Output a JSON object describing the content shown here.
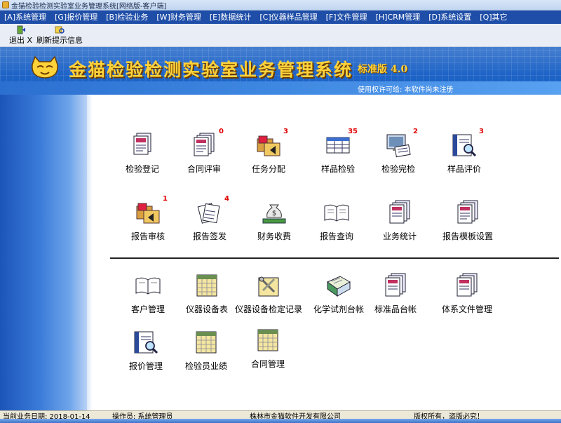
{
  "window": {
    "title": "金猫检验检测实验室业务管理系统[网络版-客户端]"
  },
  "menu": [
    {
      "label": "[A]系统管理"
    },
    {
      "label": "[G]报价管理"
    },
    {
      "label": "[B]检验业务"
    },
    {
      "label": "[W]财务管理"
    },
    {
      "label": "[E]数据统计"
    },
    {
      "label": "[C]仪器样品管理"
    },
    {
      "label": "[F]文件管理"
    },
    {
      "label": "[H]CRM管理"
    },
    {
      "label": "[D]系统设置"
    },
    {
      "label": "[Q]其它"
    }
  ],
  "toolbar": {
    "exit_label": "退出 X",
    "refresh_label": "刷新提示信息"
  },
  "banner": {
    "title": "金猫检验检测实验室业务管理系统",
    "edition": "标准版 4.0",
    "license": "使用权许可给:    本软件尚未注册"
  },
  "modules_row1": [
    {
      "label": "检验登记",
      "badge": "",
      "icon": "register-icon"
    },
    {
      "label": "合同评审",
      "badge": "0",
      "icon": "contract-review-icon"
    },
    {
      "label": "任务分配",
      "badge": "3",
      "icon": "task-assign-icon"
    },
    {
      "label": "样品检验",
      "badge": "35",
      "icon": "sample-test-icon"
    },
    {
      "label": "检验完检",
      "badge": "2",
      "icon": "test-complete-icon"
    },
    {
      "label": "样品评价",
      "badge": "3",
      "icon": "sample-evaluate-icon"
    }
  ],
  "modules_row2": [
    {
      "label": "报告审核",
      "badge": "1",
      "icon": "report-audit-icon"
    },
    {
      "label": "报告签发",
      "badge": "4",
      "icon": "report-issue-icon"
    },
    {
      "label": "财务收费",
      "badge": "",
      "icon": "money-bag-icon"
    },
    {
      "label": "报告查询",
      "badge": "",
      "icon": "open-book-icon"
    },
    {
      "label": "业务统计",
      "badge": "",
      "icon": "statistics-icon"
    },
    {
      "label": "报告模板设置",
      "badge": "",
      "icon": "template-icon"
    }
  ],
  "modules_row3": [
    {
      "label": "客户管理",
      "icon": "open-book-icon"
    },
    {
      "label": "仪器设备表",
      "icon": "calendar-icon"
    },
    {
      "label": "仪器设备检定记录",
      "icon": "tools-icon"
    },
    {
      "label": "化学试剂台帐",
      "icon": "ledger-icon"
    },
    {
      "label": "标准品台帐",
      "icon": "documents-icon"
    },
    {
      "label": "体系文件管理",
      "icon": "documents-icon"
    }
  ],
  "modules_row4": [
    {
      "label": "报价管理",
      "icon": "quote-icon"
    },
    {
      "label": "检验员业绩",
      "icon": "calendar-icon"
    },
    {
      "label": "合同管理",
      "icon": "calendar-icon"
    }
  ],
  "status": {
    "date": "当前业务日期: 2018-01-14",
    "operator": "操作员: 系统管理员",
    "company": "株林市金猫软件开发有限公司",
    "copyright": "版权所有，盗版必究！"
  },
  "colors": {
    "menubar": "#1f4ea8",
    "banner": "#1d63c6",
    "title": "#ffd23a",
    "badge": "#e00000"
  }
}
